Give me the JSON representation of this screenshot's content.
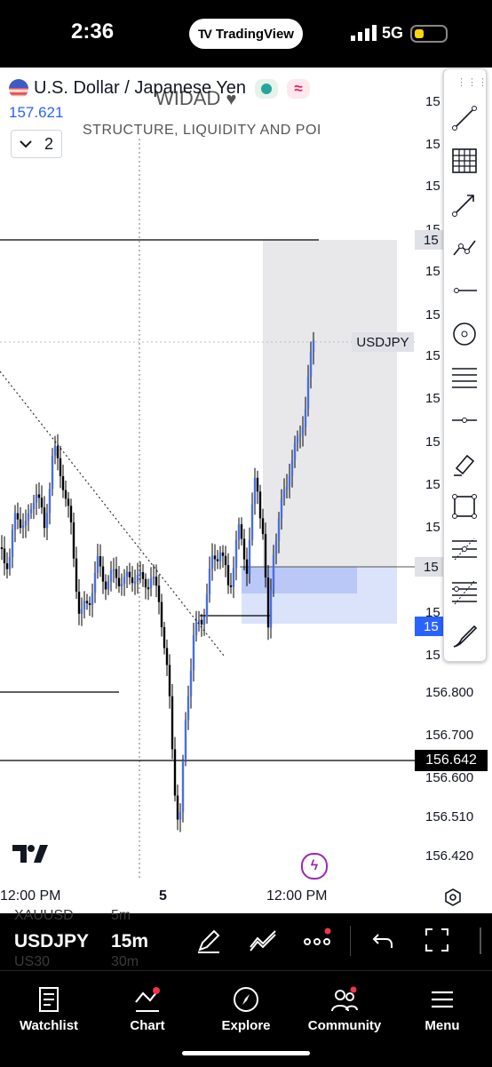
{
  "status": {
    "time": "2:36",
    "app_pill": "TradingView",
    "network": "5G"
  },
  "header": {
    "symbol": "U.S. Dollar / Japanese Yen",
    "last_price": "157.621",
    "indicator_count": "2",
    "watermark": "WIDAD",
    "indicator_title": "STRUCTURE, LIQUIDITY AND POI",
    "badge_red": "≈"
  },
  "price_axis": {
    "labels_top": [
      "15",
      "15",
      "15",
      "15",
      "15",
      "15",
      "15",
      "15",
      "15",
      "15",
      "15",
      "15",
      "15",
      "15"
    ],
    "labels_bottom": [
      "156.800",
      "156.700",
      "156.600",
      "156.510",
      "156.420"
    ],
    "current_price_label": "156.642",
    "symbol_tag": "USDJPY",
    "tag_value": "15"
  },
  "time_axis": {
    "labels": [
      "12:00 PM",
      "5",
      "12:00 PM"
    ]
  },
  "bottom_toolbar": {
    "symbol": "USDJPY",
    "interval": "15m",
    "ghost_symbols": [
      "XAUUSD",
      "US30"
    ],
    "ghost_intervals": [
      "5m",
      "30m"
    ]
  },
  "tabs": [
    {
      "label": "Watchlist",
      "icon": "watchlist-icon"
    },
    {
      "label": "Chart",
      "icon": "chart-icon"
    },
    {
      "label": "Explore",
      "icon": "compass-icon"
    },
    {
      "label": "Community",
      "icon": "community-icon"
    },
    {
      "label": "Menu",
      "icon": "menu-icon"
    }
  ],
  "colors": {
    "candle_up": "#4a6ee0",
    "candle_down": "#000000",
    "zone": "#c5d0f7",
    "accent": "#2962ff"
  }
}
